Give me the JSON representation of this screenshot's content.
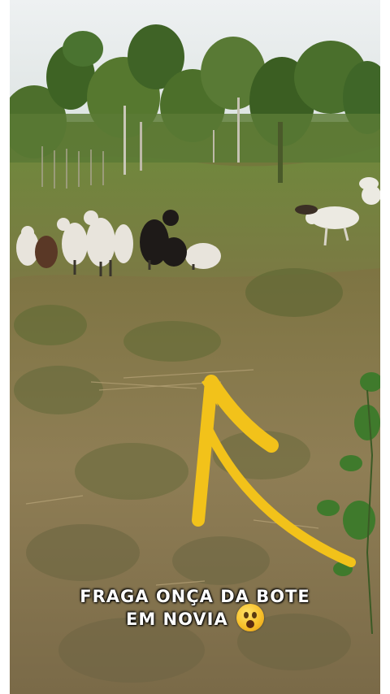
{
  "caption": {
    "line1": "FRAGA ONÇA DA BOTE",
    "line2": "EM NOVIA",
    "emoji": "astonished-face"
  },
  "colors": {
    "arrow": "#f2c21a",
    "caption_text": "#ffffff",
    "sky": "#e6ebec",
    "grass": "#8a7a4e"
  }
}
